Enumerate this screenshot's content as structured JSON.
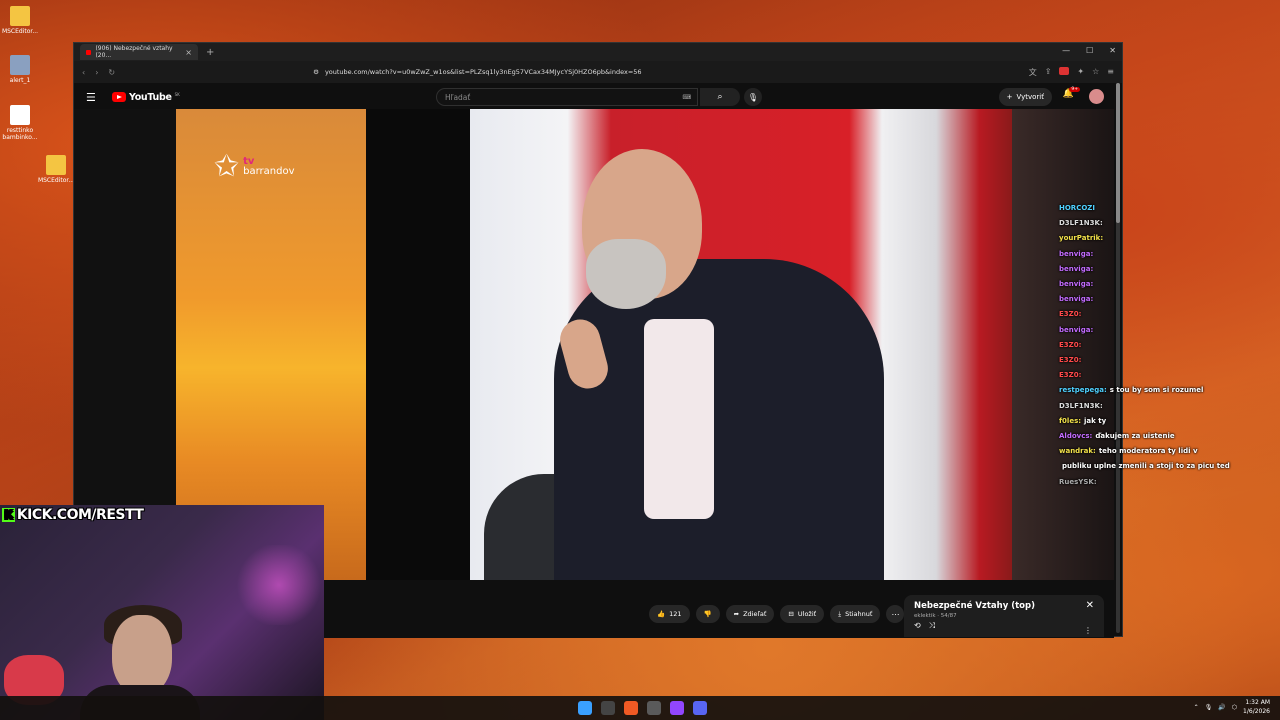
{
  "desktop": {
    "icons": [
      {
        "label": "MSCEditor...",
        "kind": "folder"
      },
      {
        "label": "alert_1",
        "kind": "bot"
      },
      {
        "label": "resttinko bambinko...",
        "kind": "doc"
      },
      {
        "label": "MSCEditor...",
        "kind": "folder"
      }
    ]
  },
  "browser": {
    "tab_title": "(906) Nebezpečné vztahy (20...",
    "new_tab": "+",
    "url": "youtube.com/watch?v=u0wZwZ_w1os&list=PLZsq1ly3nEg57VCax34MJycYSj0HZO6pb&index=56",
    "window_controls": [
      "—",
      "☐",
      "✕"
    ]
  },
  "youtube": {
    "logo_text": "YouTube",
    "logo_cc": "SK",
    "search_placeholder": "Hľadať",
    "create_label": "Vytvoriť",
    "notif_badge": "9+"
  },
  "video": {
    "channel_watermark": "barrandov",
    "channel_tv": "tv"
  },
  "chat": [
    {
      "user": "HORCOZI",
      "msg": "",
      "color": "#4fd1ff"
    },
    {
      "user": "D3LF1N3K:",
      "msg": "",
      "color": "#dddddd"
    },
    {
      "user": "yourPatrik:",
      "msg": "",
      "color": "#f2e14a"
    },
    {
      "user": "benviga:",
      "msg": "",
      "color": "#c36bff"
    },
    {
      "user": "benviga:",
      "msg": "",
      "color": "#c36bff"
    },
    {
      "user": "benviga:",
      "msg": "",
      "color": "#c36bff"
    },
    {
      "user": "benviga:",
      "msg": "",
      "color": "#c36bff"
    },
    {
      "user": "E3Z0:",
      "msg": "",
      "color": "#ff4a4a"
    },
    {
      "user": "benviga:",
      "msg": "",
      "color": "#c36bff"
    },
    {
      "user": "E3Z0:",
      "msg": "",
      "color": "#ff4a4a"
    },
    {
      "user": "E3Z0:",
      "msg": "",
      "color": "#ff4a4a"
    },
    {
      "user": "E3Z0:",
      "msg": "",
      "color": "#ff4a4a"
    },
    {
      "user": "restpepega:",
      "msg": "s tou by som si rozumel",
      "color": "#4fd1ff"
    },
    {
      "user": "D3LF1N3K:",
      "msg": "",
      "color": "#dddddd"
    },
    {
      "user": "f0les:",
      "msg": "jak ty",
      "color": "#f2e14a"
    },
    {
      "user": "Aldovcs:",
      "msg": "ďakujem za uistenie",
      "color": "#c36bff"
    },
    {
      "user": "wandrak:",
      "msg": "teho moderatora ty lidi v",
      "color": "#f2e14a"
    },
    {
      "user": "",
      "msg": "publiku uplne zmenili a stoji to za picu ted",
      "color": "#ffffff"
    },
    {
      "user": "RuesYSK:",
      "msg": "",
      "color": "#aaaaaa"
    }
  ],
  "actions": {
    "likes": "121",
    "share": "Zdieľať",
    "save": "Uložiť",
    "download": "Stiahnuť"
  },
  "playlist": {
    "title": "Nebezpečné Vztahy (top)",
    "subtitle": "eklektik · 54/87"
  },
  "stream": {
    "kick_label": "KICK.COM/RESTT",
    "kick_k": "K"
  },
  "taskbar": {
    "time": "1:32 AM",
    "date": "1/6/2026"
  }
}
